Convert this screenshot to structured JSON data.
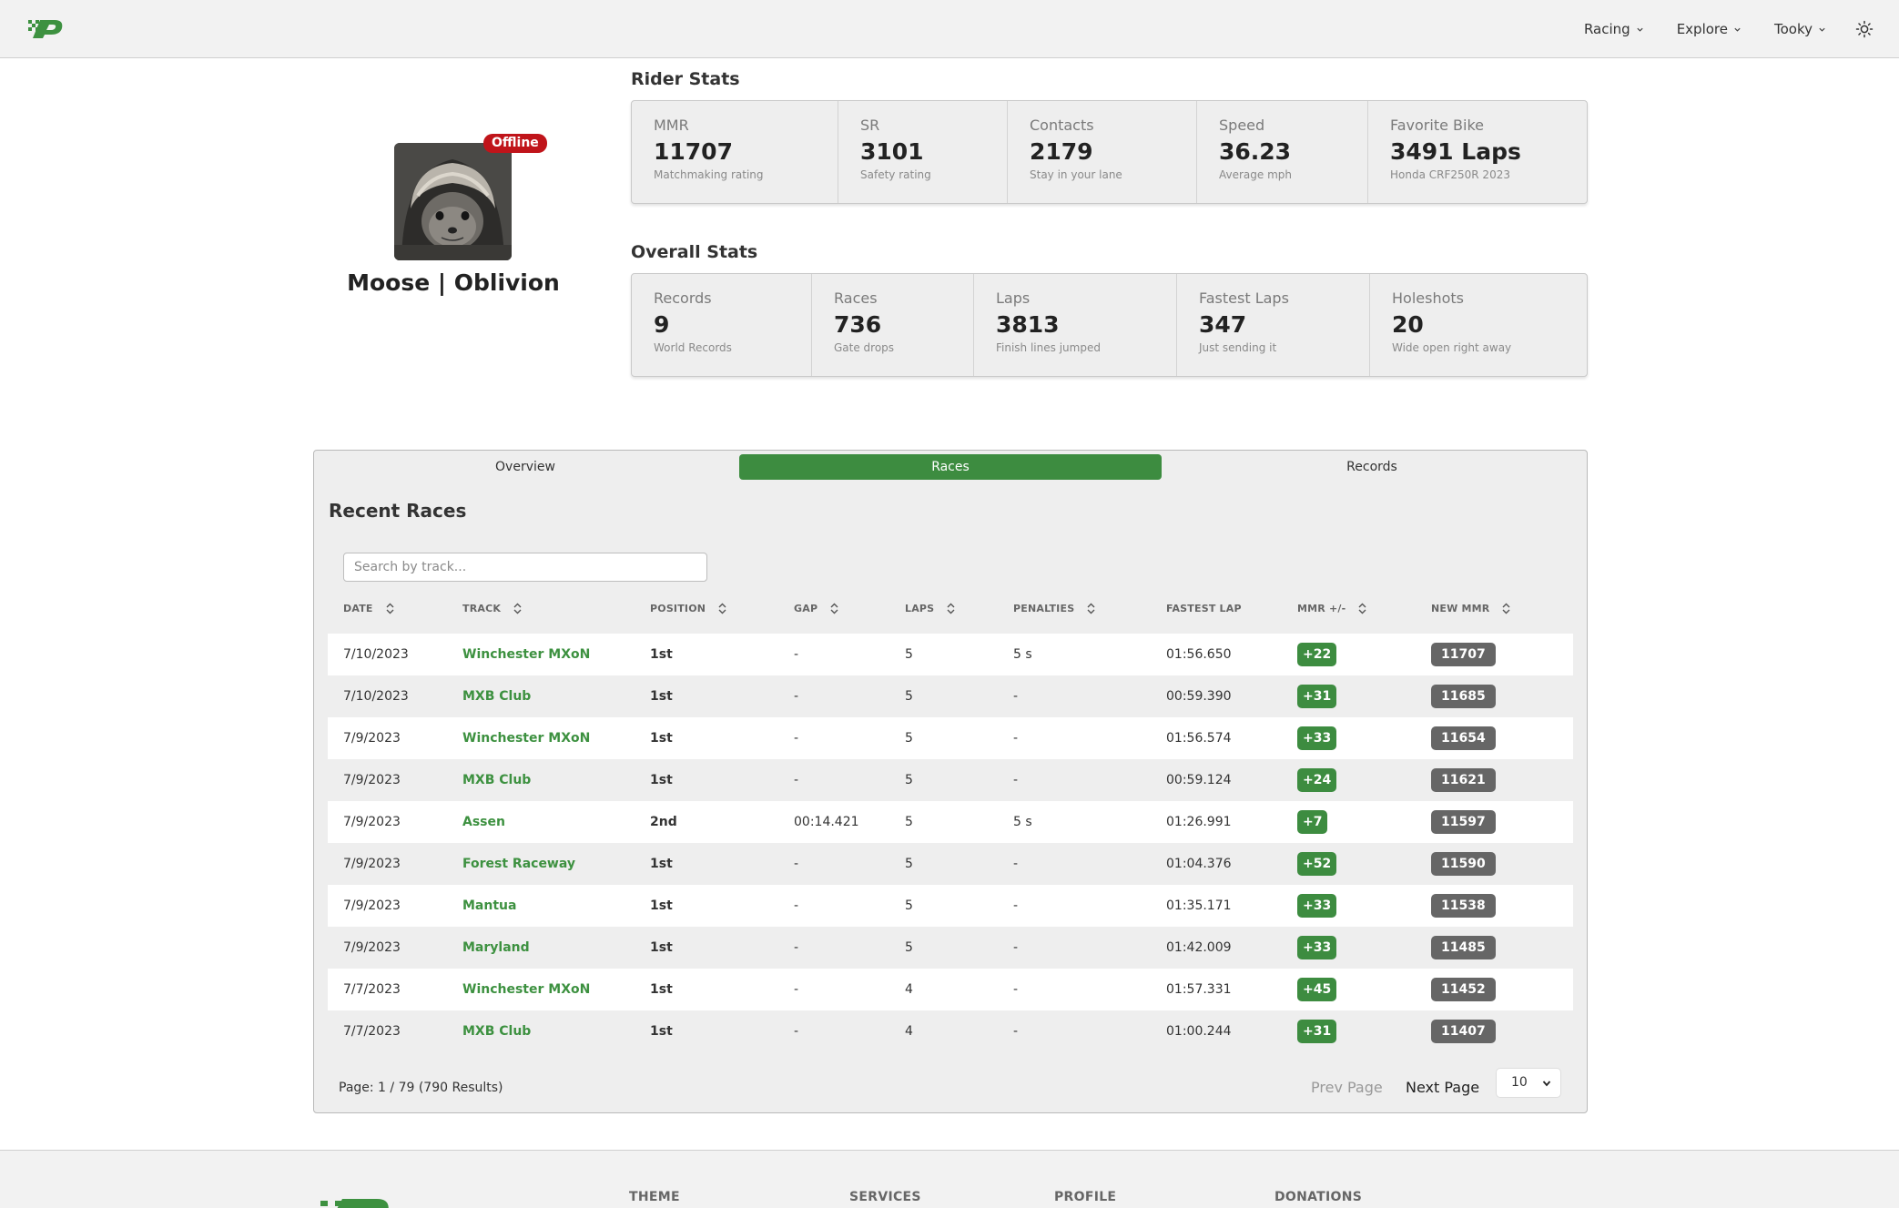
{
  "nav": {
    "items": [
      {
        "label": "Racing"
      },
      {
        "label": "Explore"
      },
      {
        "label": "Tooky"
      }
    ]
  },
  "profile": {
    "name": "Moose | Oblivion",
    "status": "Offline"
  },
  "rider_stats": {
    "title": "Rider Stats",
    "items": [
      {
        "label": "MMR",
        "value": "11707",
        "desc": "Matchmaking rating"
      },
      {
        "label": "SR",
        "value": "3101",
        "desc": "Safety rating"
      },
      {
        "label": "Contacts",
        "value": "2179",
        "desc": "Stay in your lane"
      },
      {
        "label": "Speed",
        "value": "36.23",
        "desc": "Average mph"
      },
      {
        "label": "Favorite Bike",
        "value": "3491 Laps",
        "desc": "Honda CRF250R 2023"
      }
    ]
  },
  "overall_stats": {
    "title": "Overall Stats",
    "items": [
      {
        "label": "Records",
        "value": "9",
        "desc": "World Records"
      },
      {
        "label": "Races",
        "value": "736",
        "desc": "Gate drops"
      },
      {
        "label": "Laps",
        "value": "3813",
        "desc": "Finish lines jumped"
      },
      {
        "label": "Fastest Laps",
        "value": "347",
        "desc": "Just sending it"
      },
      {
        "label": "Holeshots",
        "value": "20",
        "desc": "Wide open right away"
      }
    ]
  },
  "tabs": [
    {
      "label": "Overview"
    },
    {
      "label": "Races"
    },
    {
      "label": "Records"
    }
  ],
  "races": {
    "title": "Recent Races",
    "search_placeholder": "Search by track...",
    "columns": {
      "date": "DATE",
      "track": "TRACK",
      "position": "POSITION",
      "gap": "GAP",
      "laps": "LAPS",
      "penalties": "PENALTIES",
      "fastest_lap": "FASTEST LAP",
      "mmr_change": "MMR +/-",
      "new_mmr": "NEW MMR"
    },
    "rows": [
      {
        "date": "7/10/2023",
        "track": "Winchester MXoN",
        "position": "1st",
        "gap": "-",
        "laps": "5",
        "penalties": "5 s",
        "fastest_lap": "01:56.650",
        "mmr_change": "+22",
        "new_mmr": "11707"
      },
      {
        "date": "7/10/2023",
        "track": "MXB Club",
        "position": "1st",
        "gap": "-",
        "laps": "5",
        "penalties": "-",
        "fastest_lap": "00:59.390",
        "mmr_change": "+31",
        "new_mmr": "11685"
      },
      {
        "date": "7/9/2023",
        "track": "Winchester MXoN",
        "position": "1st",
        "gap": "-",
        "laps": "5",
        "penalties": "-",
        "fastest_lap": "01:56.574",
        "mmr_change": "+33",
        "new_mmr": "11654"
      },
      {
        "date": "7/9/2023",
        "track": "MXB Club",
        "position": "1st",
        "gap": "-",
        "laps": "5",
        "penalties": "-",
        "fastest_lap": "00:59.124",
        "mmr_change": "+24",
        "new_mmr": "11621"
      },
      {
        "date": "7/9/2023",
        "track": "Assen",
        "position": "2nd",
        "gap": "00:14.421",
        "laps": "5",
        "penalties": "5 s",
        "fastest_lap": "01:26.991",
        "mmr_change": "+7",
        "new_mmr": "11597"
      },
      {
        "date": "7/9/2023",
        "track": "Forest Raceway",
        "position": "1st",
        "gap": "-",
        "laps": "5",
        "penalties": "-",
        "fastest_lap": "01:04.376",
        "mmr_change": "+52",
        "new_mmr": "11590"
      },
      {
        "date": "7/9/2023",
        "track": "Mantua",
        "position": "1st",
        "gap": "-",
        "laps": "5",
        "penalties": "-",
        "fastest_lap": "01:35.171",
        "mmr_change": "+33",
        "new_mmr": "11538"
      },
      {
        "date": "7/9/2023",
        "track": "Maryland",
        "position": "1st",
        "gap": "-",
        "laps": "5",
        "penalties": "-",
        "fastest_lap": "01:42.009",
        "mmr_change": "+33",
        "new_mmr": "11485"
      },
      {
        "date": "7/7/2023",
        "track": "Winchester MXoN",
        "position": "1st",
        "gap": "-",
        "laps": "4",
        "penalties": "-",
        "fastest_lap": "01:57.331",
        "mmr_change": "+45",
        "new_mmr": "11452"
      },
      {
        "date": "7/7/2023",
        "track": "MXB Club",
        "position": "1st",
        "gap": "-",
        "laps": "4",
        "penalties": "-",
        "fastest_lap": "01:00.244",
        "mmr_change": "+31",
        "new_mmr": "11407"
      }
    ],
    "pager": {
      "info": "Page: 1 / 79  (790 Results)",
      "prev": "Prev Page",
      "next": "Next Page",
      "page_size": "10"
    }
  },
  "footer": {
    "columns": [
      {
        "label": "THEME"
      },
      {
        "label": "SERVICES"
      },
      {
        "label": "PROFILE"
      },
      {
        "label": "DONATIONS"
      }
    ]
  },
  "colors": {
    "brand_green": "#3d8c40",
    "offline_red": "#c0141a",
    "mmr_badge_gray": "#666666"
  }
}
